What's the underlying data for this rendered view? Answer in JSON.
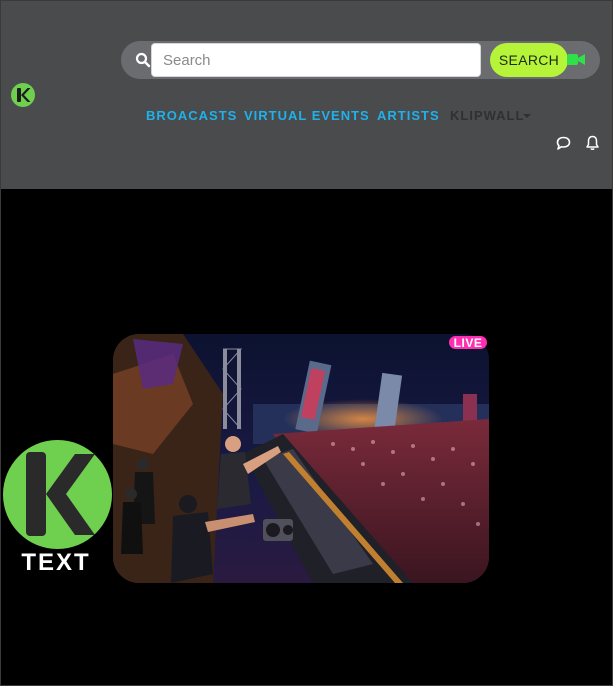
{
  "search": {
    "placeholder": "Search",
    "button_label": "SEARCH"
  },
  "nav": {
    "broadcasts": "BROACASTS",
    "virtual_events": "VIRTUAL EVENTS",
    "artists": "ARTISTS",
    "klipwall": "KLIPWALL"
  },
  "video": {
    "live_badge": "LIVE"
  },
  "brand": {
    "logo_text": "TEXT",
    "accent": "#6fcf4f",
    "search_accent": "#b6f43a",
    "nav_link": "#1fb1ec",
    "live_color": "#ff2fb3"
  },
  "icons": [
    "logo-icon",
    "search-icon",
    "video-camera-icon",
    "caret-down-icon",
    "chat-icon",
    "bell-icon"
  ]
}
